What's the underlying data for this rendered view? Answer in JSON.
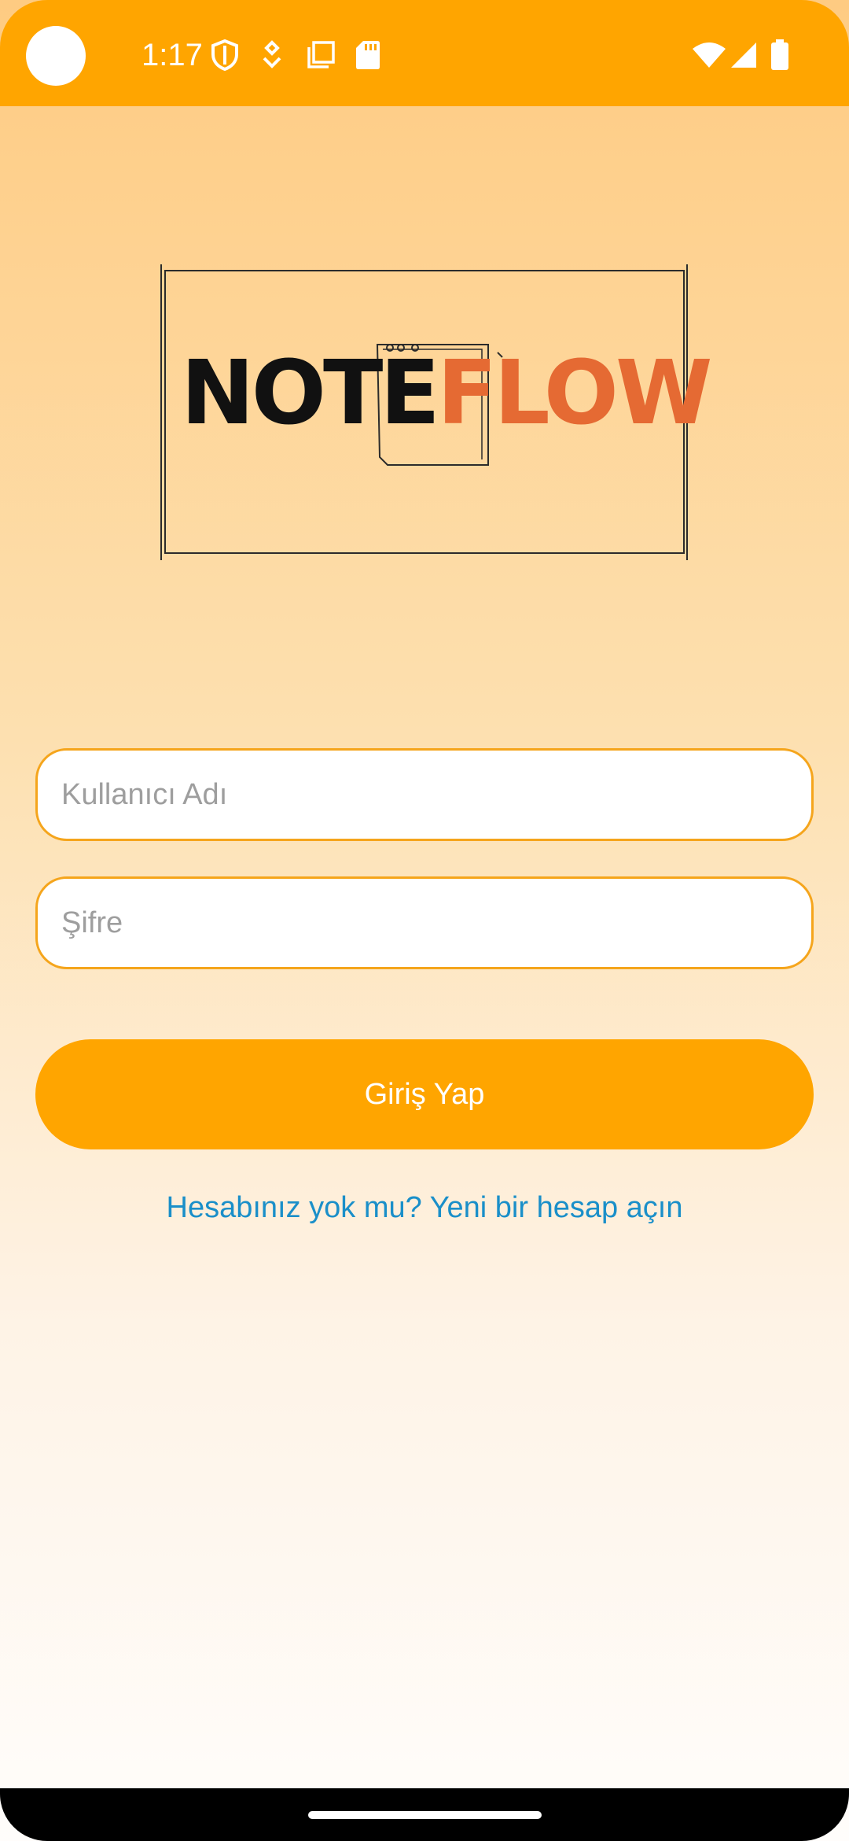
{
  "status_bar": {
    "time": "1:17",
    "left_icons": [
      "shield-icon",
      "location-icon",
      "copy-icon",
      "sd-card-icon"
    ],
    "right_icons": [
      "wifi-icon",
      "signal-icon",
      "battery-icon"
    ],
    "color": "#ffa500"
  },
  "logo": {
    "part1": "NOTE",
    "part2": "FLOW",
    "part1_color": "#111111",
    "part2_color": "#e56a33"
  },
  "form": {
    "username_placeholder": "Kullanıcı Adı",
    "username_value": "",
    "password_placeholder": "Şifre",
    "password_value": "",
    "login_label": "Giriş Yap",
    "signup_link": "Hesabınız yok mu? Yeni bir hesap açın"
  },
  "colors": {
    "accent": "#ffa500",
    "link": "#1a8fc9",
    "input_border": "#f5a51c"
  }
}
